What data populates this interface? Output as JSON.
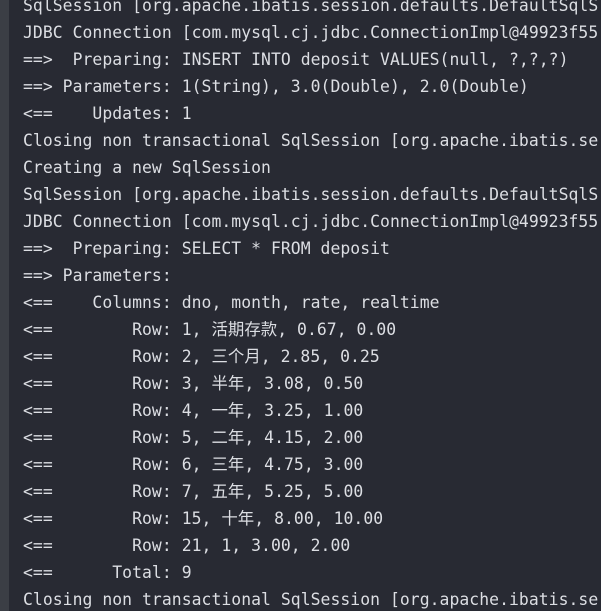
{
  "colors": {
    "background": "#282a33",
    "gutter": "#3b3e45",
    "text": "#dcdee3"
  },
  "console": {
    "lines": [
      "SqlSession [org.apache.ibatis.session.defaults.DefaultSqlS",
      "JDBC Connection [com.mysql.cj.jdbc.ConnectionImpl@49923f55",
      "==>  Preparing: INSERT INTO deposit VALUES(null, ?,?,?)",
      "==> Parameters: 1(String), 3.0(Double), 2.0(Double)",
      "<==    Updates: 1",
      "Closing non transactional SqlSession [org.apache.ibatis.se",
      "Creating a new SqlSession",
      "SqlSession [org.apache.ibatis.session.defaults.DefaultSqlS",
      "JDBC Connection [com.mysql.cj.jdbc.ConnectionImpl@49923f55",
      "==>  Preparing: SELECT * FROM deposit",
      "==> Parameters: ",
      "<==    Columns: dno, month, rate, realtime",
      "<==        Row: 1, 活期存款, 0.67, 0.00",
      "<==        Row: 2, 三个月, 2.85, 0.25",
      "<==        Row: 3, 半年, 3.08, 0.50",
      "<==        Row: 4, 一年, 3.25, 1.00",
      "<==        Row: 5, 二年, 4.15, 2.00",
      "<==        Row: 6, 三年, 4.75, 3.00",
      "<==        Row: 7, 五年, 5.25, 5.00",
      "<==        Row: 15, 十年, 8.00, 10.00",
      "<==        Row: 21, 1, 3.00, 2.00",
      "<==      Total: 9",
      "Closing non transactional SqlSession [org.apache.ibatis.se"
    ]
  }
}
